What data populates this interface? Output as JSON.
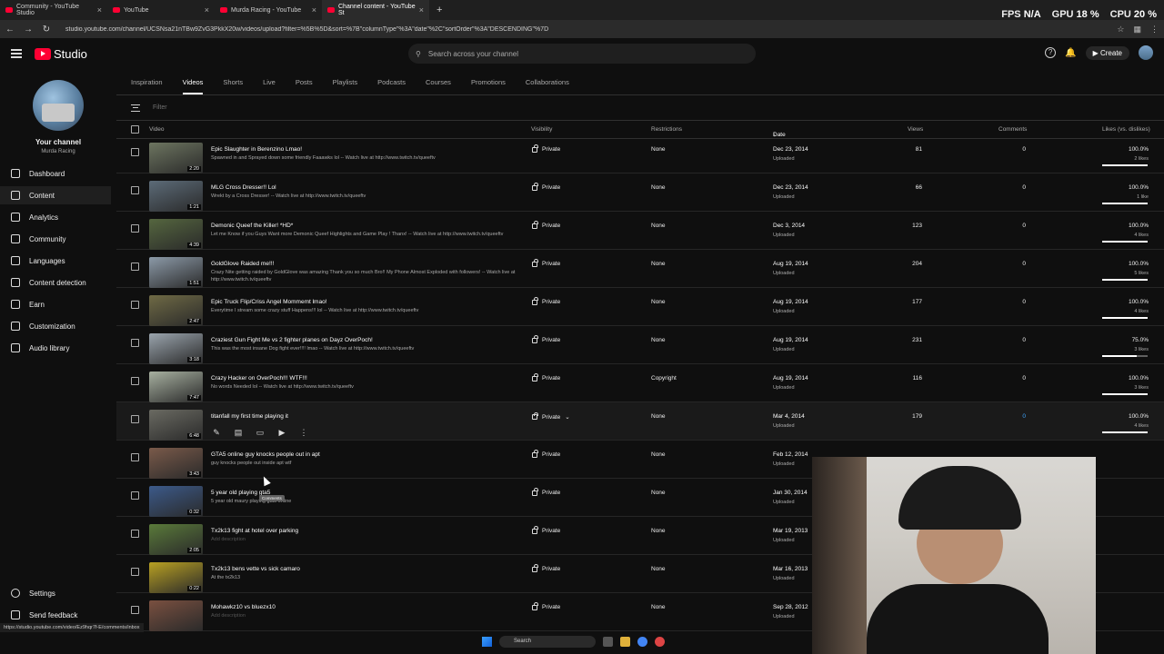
{
  "browser": {
    "tabs": [
      {
        "label": "Community - YouTube Studio",
        "active": false
      },
      {
        "label": "YouTube",
        "active": false
      },
      {
        "label": "Murda Racing - YouTube",
        "active": false
      },
      {
        "label": "Channel content - YouTube St",
        "active": true
      }
    ],
    "url": "studio.youtube.com/channel/UCSNsa21nTBw9ZvG3PkkX20w/videos/upload?filter=%5B%5D&sort=%7B\"columnType\"%3A\"date\"%2C\"sortOrder\"%3A\"DESCENDING\"%7D",
    "status_url": "https://studio.youtube.com/video/Ez9hqr7f-E/comments/inbox"
  },
  "overlay": {
    "fps_label": "FPS",
    "fps_value": "N/A",
    "gpu_label": "GPU",
    "gpu_value": "18 %",
    "cpu_label": "CPU",
    "cpu_value": "20 %"
  },
  "header": {
    "logo_text": "Studio",
    "search_placeholder": "Search across your channel",
    "create_label": "Create"
  },
  "sidebar": {
    "channel_title": "Your channel",
    "channel_name": "Murda Racing",
    "items": [
      "Dashboard",
      "Content",
      "Analytics",
      "Community",
      "Languages",
      "Content detection",
      "Earn",
      "Customization",
      "Audio library"
    ],
    "active_index": 1,
    "settings": "Settings",
    "feedback": "Send feedback"
  },
  "tabs": [
    "Inspiration",
    "Videos",
    "Shorts",
    "Live",
    "Posts",
    "Playlists",
    "Podcasts",
    "Courses",
    "Promotions",
    "Collaborations"
  ],
  "active_tab": 1,
  "filter_placeholder": "Filter",
  "columns": {
    "video": "Video",
    "visibility": "Visibility",
    "restrictions": "Restrictions",
    "date": "Date",
    "views": "Views",
    "comments": "Comments",
    "likes": "Likes (vs. dislikes)"
  },
  "videos": [
    {
      "title": "Epic Slaughter in Berenzino Lmao!",
      "desc": "Spawned in and Sprayed down some friendly Faaawks lol -- Watch live at http://www.twitch.tv/queeftv",
      "duration": "2:20",
      "visibility": "Private",
      "restrictions": "None",
      "date": "Dec 23, 2014",
      "status": "Uploaded",
      "views": "81",
      "comments": "0",
      "likes": "100.0%",
      "like_count": "2 likes",
      "like_ratio": 1.0,
      "thumb": "#6d7560"
    },
    {
      "title": "MLG Cross Dresser!! Lol",
      "desc": "Wrekt by a Cross Dresser! -- Watch live at http://www.twitch.tv/queeftv",
      "duration": "1:21",
      "visibility": "Private",
      "restrictions": "None",
      "date": "Dec 23, 2014",
      "status": "Uploaded",
      "views": "66",
      "comments": "0",
      "likes": "100.0%",
      "like_count": "1 like",
      "like_ratio": 1.0,
      "thumb": "#5c6b78"
    },
    {
      "title": "Demonic Queef the Killer! *HD*",
      "desc": "Let me Know if you Guys Want more Demonic Queef Highlights and Game Play ! Thanx! -- Watch live at http://www.twitch.tv/queeftv",
      "duration": "4:39",
      "visibility": "Private",
      "restrictions": "None",
      "date": "Dec 3, 2014",
      "status": "Uploaded",
      "views": "123",
      "comments": "0",
      "likes": "100.0%",
      "like_count": "4 likes",
      "like_ratio": 1.0,
      "thumb": "#55663f"
    },
    {
      "title": "GoldGlove Raided me!!!",
      "desc": "Crazy Nite getting raided by GoldGlove was amazing Thank you so much Bro!! My Phone Almost Exploded with followers! -- Watch live at http://www.twitch.tv/queeftv",
      "duration": "1:51",
      "visibility": "Private",
      "restrictions": "None",
      "date": "Aug 19, 2014",
      "status": "Uploaded",
      "views": "204",
      "comments": "0",
      "likes": "100.0%",
      "like_count": "5 likes",
      "like_ratio": 1.0,
      "thumb": "#8c9aa8"
    },
    {
      "title": "Epic Truck Flip/Criss Angel Mommemt lmao!",
      "desc": "Everytime I stream some crazy stuff Happens!!! lol -- Watch live at http://www.twitch.tv/queeftv",
      "duration": "2:47",
      "visibility": "Private",
      "restrictions": "None",
      "date": "Aug 19, 2014",
      "status": "Uploaded",
      "views": "177",
      "comments": "0",
      "likes": "100.0%",
      "like_count": "4 likes",
      "like_ratio": 1.0,
      "thumb": "#6f6a45"
    },
    {
      "title": "Craziest Gun Fight Me vs 2 fighter planes on Dayz OverPoch!",
      "desc": "This was the most insane Dog fight ever!!!! lmao -- Watch live at http://www.twitch.tv/queeftv",
      "duration": "3:18",
      "visibility": "Private",
      "restrictions": "None",
      "date": "Aug 19, 2014",
      "status": "Uploaded",
      "views": "231",
      "comments": "0",
      "likes": "75.0%",
      "like_count": "3 likes",
      "like_ratio": 0.75,
      "thumb": "#9aa4ad"
    },
    {
      "title": "Crazy Hacker on OverPoch!!! WTF!!!",
      "desc": "No words Needed lol -- Watch live at http://www.twitch.tv/queeftv",
      "duration": "7:47",
      "visibility": "Private",
      "restrictions": "Copyright",
      "date": "Aug 19, 2014",
      "status": "Uploaded",
      "views": "116",
      "comments": "0",
      "likes": "100.0%",
      "like_count": "3 likes",
      "like_ratio": 1.0,
      "thumb": "#a7b0a0"
    },
    {
      "title": "titanfall my first time playing it",
      "desc": "",
      "duration": "6:48",
      "visibility": "Private",
      "restrictions": "None",
      "date": "Mar 4, 2014",
      "status": "Uploaded",
      "views": "179",
      "comments": "0",
      "likes": "100.0%",
      "like_count": "4 likes",
      "like_ratio": 1.0,
      "thumb": "#6a6a62",
      "hover": true
    },
    {
      "title": "GTA5 online guy knocks people out in apt",
      "desc": "guy knocks people out inside apt wtf",
      "duration": "3:43",
      "visibility": "Private",
      "restrictions": "None",
      "date": "Feb 12, 2014",
      "status": "Uploaded",
      "views": "",
      "comments": "",
      "likes": "",
      "like_count": "",
      "thumb": "#7a5a4a"
    },
    {
      "title": "5 year old playing gta5",
      "desc": "5 year old maury playing gta5 online",
      "duration": "0:32",
      "visibility": "Private",
      "restrictions": "None",
      "date": "Jan 30, 2014",
      "status": "Uploaded",
      "views": "",
      "comments": "",
      "likes": "",
      "like_count": "",
      "thumb": "#3c5a8a"
    },
    {
      "title": "Tx2k13 fight at hotel over parking",
      "desc": "Add description",
      "desc_muted": true,
      "duration": "2:05",
      "visibility": "Private",
      "restrictions": "None",
      "date": "Mar 19, 2013",
      "status": "Uploaded",
      "views": "",
      "comments": "",
      "likes": "",
      "like_count": "",
      "thumb": "#5a7a3a"
    },
    {
      "title": "Tx2k13 bens vette vs sick camaro",
      "desc": "At the tx2k13",
      "duration": "0:22",
      "visibility": "Private",
      "restrictions": "None",
      "date": "Mar 16, 2013",
      "status": "Uploaded",
      "views": "",
      "comments": "",
      "likes": "",
      "like_count": "",
      "thumb": "#b8a022"
    },
    {
      "title": "Mohawkz10 vs bluezx10",
      "desc": "Add description",
      "desc_muted": true,
      "duration": "",
      "visibility": "Private",
      "restrictions": "None",
      "date": "Sep 28, 2012",
      "status": "Uploaded",
      "views": "",
      "comments": "",
      "likes": "",
      "like_count": "",
      "thumb": "#7a5040"
    }
  ],
  "tooltip": "Comments",
  "taskbar": {
    "search_placeholder": "Search"
  }
}
